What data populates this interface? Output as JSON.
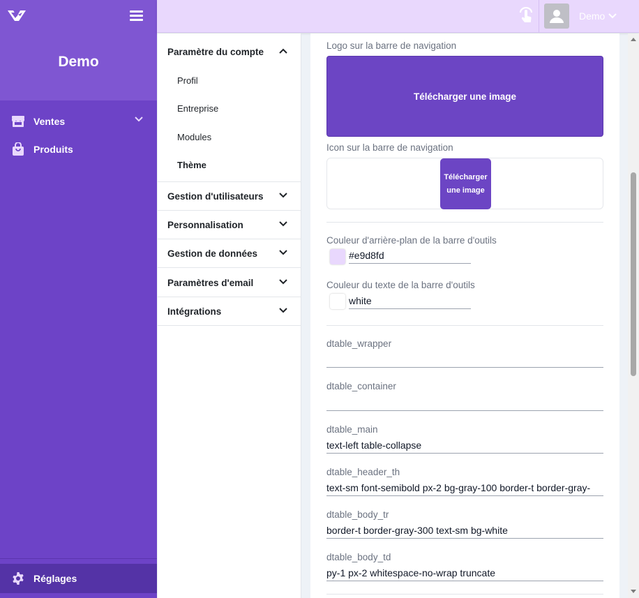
{
  "sidebar": {
    "brand": "Demo",
    "items": [
      {
        "label": "Ventes",
        "icon": "store-icon",
        "expandable": true
      },
      {
        "label": "Produits",
        "icon": "shopping-bag-icon",
        "expandable": false
      }
    ],
    "settings_label": "Réglages",
    "settings_icon": "gear-icon",
    "colors": {
      "background": "#6d43c7",
      "brand_area": "#7f56d2",
      "active": "#5433a6"
    }
  },
  "topbar": {
    "user_name": "Demo",
    "icons": [
      "touch-icon",
      "avatar-icon",
      "chevron-down-icon"
    ],
    "background": "#e9d8fd"
  },
  "settings_menu": {
    "account_section": "Paramètre du compte",
    "account_items": [
      "Profil",
      "Entreprise",
      "Modules",
      "Thème"
    ],
    "active_item": "Thème",
    "sections": [
      "Gestion d'utilisateurs",
      "Personnalisation",
      "Gestion de données",
      "Paramètres d'email",
      "Intégrations"
    ]
  },
  "theme": {
    "navbar_logo_label": "Logo sur la barre de navigation",
    "upload_label": "Télécharger une image",
    "upload_small_line1": "Télécharger",
    "upload_small_line2": "une image",
    "navbar_icon_label": "Icon sur la barre de navigation",
    "toolbar_bg_label": "Couleur d'arrière-plan de la barre d'outils",
    "toolbar_bg_value": "#e9d8fd",
    "toolbar_text_label": "Couleur du texte de la barre d'outils",
    "toolbar_text_value": "white",
    "fields": [
      {
        "label": "dtable_wrapper",
        "value": ""
      },
      {
        "label": "dtable_container",
        "value": ""
      },
      {
        "label": "dtable_main",
        "value": "text-left table-collapse"
      },
      {
        "label": "dtable_header_th",
        "value": "text-sm font-semibold px-2 bg-gray-100 border-t border-gray-"
      },
      {
        "label": "dtable_body_tr",
        "value": "border-t border-gray-300 text-sm bg-white"
      },
      {
        "label": "dtable_body_td",
        "value": "py-1 px-2 whitespace-no-wrap truncate"
      }
    ],
    "accent_color": "#6c45c4"
  }
}
